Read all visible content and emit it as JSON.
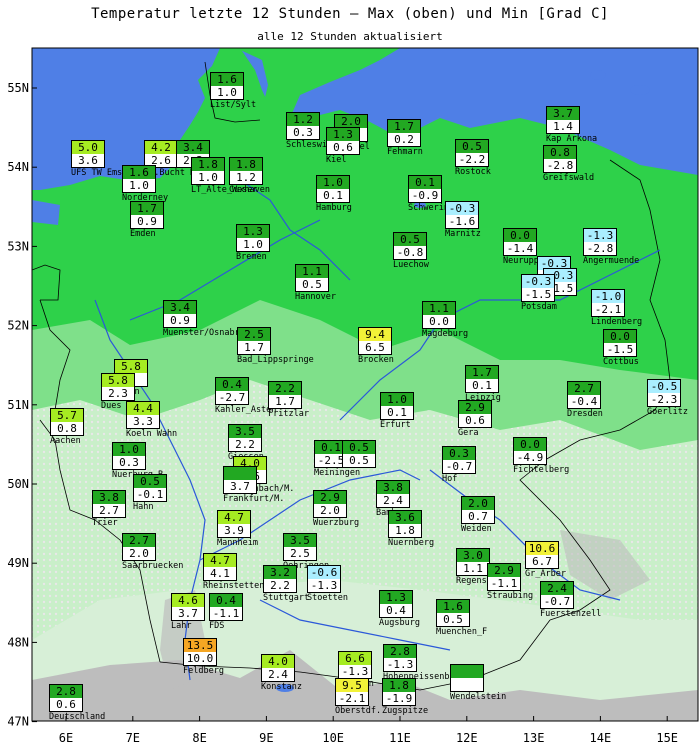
{
  "title": "Temperatur letzte 12 Stunden — Max (oben) und Min [Grad C]",
  "subtitle": "alle 12 Stunden aktualisiert",
  "axes": {
    "lon_ticks": [
      "6E",
      "7E",
      "8E",
      "9E",
      "10E",
      "11E",
      "12E",
      "13E",
      "14E",
      "15E"
    ],
    "lat_ticks": [
      "55N",
      "54N",
      "53N",
      "52N",
      "51N",
      "50N",
      "49N",
      "48N",
      "47N"
    ]
  },
  "colors": {
    "sea": "#4f7fe6",
    "lowland": "#2ed14a",
    "midland": "#7fe08a",
    "upland": "#c9efc9",
    "mountain": "#bdbdbd",
    "max_green": "#22a822",
    "max_light": "#a6ec22",
    "max_yellow": "#f2f238",
    "max_orange": "#f5a623",
    "max_cyan": "#aaeeff"
  },
  "stations": [
    {
      "name": "List/Sylt",
      "max": "1.6",
      "min": "1.0",
      "lon": 8.41,
      "lat": 55.02,
      "c": "max_green"
    },
    {
      "name": "UFS TW Ems",
      "max": "5.0",
      "min": "3.6",
      "lon": 6.33,
      "lat": 54.17,
      "c": "max_light"
    },
    {
      "name": "Dt.Bucht H.",
      "max": "4.2",
      "min": "2.6",
      "lon": 7.42,
      "lat": 54.17,
      "c": "max_light"
    },
    {
      "name": "",
      "max": "3.4",
      "min": "2.3",
      "lon": 7.9,
      "lat": 54.17,
      "c": "max_green"
    },
    {
      "name": "Schleswig",
      "max": "1.2",
      "min": "0.3",
      "lon": 9.55,
      "lat": 54.52,
      "c": "max_green"
    },
    {
      "name": "LT_Kiel",
      "max": "2.0",
      "min": "",
      "lon": 10.27,
      "lat": 54.5,
      "c": "max_green"
    },
    {
      "name": "Kiel",
      "max": "1.3",
      "min": "0.6",
      "lon": 10.15,
      "lat": 54.33,
      "c": "max_green"
    },
    {
      "name": "Fehmarn",
      "max": "1.7",
      "min": "0.2",
      "lon": 11.06,
      "lat": 54.43,
      "c": "max_green"
    },
    {
      "name": "Kap Arkona",
      "max": "3.7",
      "min": "1.4",
      "lon": 13.44,
      "lat": 54.6,
      "c": "max_green"
    },
    {
      "name": "Rostock",
      "max": "0.5",
      "min": "-2.2",
      "lon": 12.08,
      "lat": 54.18,
      "c": "max_green"
    },
    {
      "name": "Greifswald",
      "max": "0.8",
      "min": "-2.8",
      "lon": 13.4,
      "lat": 54.1,
      "c": "max_green"
    },
    {
      "name": "Cuxhaven",
      "max": "1.8",
      "min": "1.2",
      "lon": 8.7,
      "lat": 53.95,
      "c": "max_green"
    },
    {
      "name": "Norderney",
      "max": "1.6",
      "min": "1.0",
      "lon": 7.1,
      "lat": 53.85,
      "c": "max_green"
    },
    {
      "name": "LT_Alte_Weser",
      "max": "1.8",
      "min": "1.0",
      "lon": 8.13,
      "lat": 53.95,
      "c": "max_green"
    },
    {
      "name": "Hamburg",
      "max": "1.0",
      "min": "0.1",
      "lon": 9.99,
      "lat": 53.73,
      "c": "max_green"
    },
    {
      "name": "Schwerin",
      "max": "0.1",
      "min": "-0.9",
      "lon": 11.38,
      "lat": 53.73,
      "c": "max_green"
    },
    {
      "name": "Marnitz",
      "max": "-0.3",
      "min": "-1.6",
      "lon": 11.93,
      "lat": 53.4,
      "c": "max_cyan"
    },
    {
      "name": "Emden",
      "max": "1.7",
      "min": "0.9",
      "lon": 7.21,
      "lat": 53.4,
      "c": "max_green"
    },
    {
      "name": "Neuruppin",
      "max": "0.0",
      "min": "-1.4",
      "lon": 12.8,
      "lat": 53.05,
      "c": "max_green"
    },
    {
      "name": "Angermuende",
      "max": "-1.3",
      "min": "-2.8",
      "lon": 13.99,
      "lat": 53.05,
      "c": "max_cyan"
    },
    {
      "name": "Bremen",
      "max": "1.3",
      "min": "1.0",
      "lon": 8.8,
      "lat": 53.1,
      "c": "max_green"
    },
    {
      "name": "Luechow",
      "max": "0.5",
      "min": "-0.8",
      "lon": 11.15,
      "lat": 53.0,
      "c": "max_green"
    },
    {
      "name": "Tegel",
      "max": "-0.3",
      "min": "",
      "lon": 13.3,
      "lat": 52.7,
      "c": "max_cyan"
    },
    {
      "name": "",
      "max": "-0.3",
      "min": "-1.5",
      "lon": 13.4,
      "lat": 52.55,
      "c": "max_cyan"
    },
    {
      "name": "Potsdam",
      "max": "-0.3",
      "min": "-1.5",
      "lon": 13.06,
      "lat": 52.47,
      "c": "max_cyan"
    },
    {
      "name": "Hannover",
      "max": "1.1",
      "min": "0.5",
      "lon": 9.68,
      "lat": 52.6,
      "c": "max_green"
    },
    {
      "name": "Lindenberg",
      "max": "-1.0",
      "min": "-2.1",
      "lon": 14.12,
      "lat": 52.28,
      "c": "max_cyan"
    },
    {
      "name": "Muenster/Osnabr.",
      "max": "3.4",
      "min": "0.9",
      "lon": 7.7,
      "lat": 52.15,
      "c": "max_green"
    },
    {
      "name": "Magdeburg",
      "max": "1.1",
      "min": "0.0",
      "lon": 11.58,
      "lat": 52.13,
      "c": "max_green"
    },
    {
      "name": "Bad_Lippspringe",
      "max": "2.5",
      "min": "1.7",
      "lon": 8.82,
      "lat": 51.8,
      "c": "max_green"
    },
    {
      "name": "Brocken",
      "max": "9.4",
      "min": "6.5",
      "lon": 10.62,
      "lat": 51.8,
      "c": "max_yellow"
    },
    {
      "name": "Cottbus",
      "max": "0.0",
      "min": "-1.5",
      "lon": 14.3,
      "lat": 51.78,
      "c": "max_green"
    },
    {
      "name": "Essen",
      "max": "5.8",
      "min": "5",
      "lon": 6.98,
      "lat": 51.4,
      "c": "max_light"
    },
    {
      "name": "Dues",
      "max": "5.8",
      "min": "2.3",
      "lon": 6.78,
      "lat": 51.22,
      "c": "max_light"
    },
    {
      "name": "Leipzig",
      "max": "1.7",
      "min": "0.1",
      "lon": 12.23,
      "lat": 51.33,
      "c": "max_green"
    },
    {
      "name": "Kahler_Asten",
      "max": "0.4",
      "min": "-2.7",
      "lon": 8.48,
      "lat": 51.18,
      "c": "max_green"
    },
    {
      "name": "Fritzlar",
      "max": "2.2",
      "min": "1.7",
      "lon": 9.28,
      "lat": 51.13,
      "c": "max_green"
    },
    {
      "name": "Erfurt",
      "max": "1.0",
      "min": "0.1",
      "lon": 10.96,
      "lat": 50.98,
      "c": "max_green"
    },
    {
      "name": "Dresden",
      "max": "2.7",
      "min": "-0.4",
      "lon": 13.75,
      "lat": 51.13,
      "c": "max_green"
    },
    {
      "name": "Goerlitz",
      "max": "-0.5",
      "min": "-2.3",
      "lon": 14.95,
      "lat": 51.15,
      "c": "max_cyan"
    },
    {
      "name": "Koeln Wahn",
      "max": "4.4",
      "min": "3.3",
      "lon": 7.15,
      "lat": 50.87,
      "c": "max_light"
    },
    {
      "name": "Aachen",
      "max": "5.7",
      "min": "0.8",
      "lon": 6.02,
      "lat": 50.78,
      "c": "max_light"
    },
    {
      "name": "Gera",
      "max": "2.9",
      "min": "0.6",
      "lon": 12.13,
      "lat": 50.88,
      "c": "max_green"
    },
    {
      "name": "Giessen",
      "max": "3.5",
      "min": "2.2",
      "lon": 8.68,
      "lat": 50.58,
      "c": "max_green"
    },
    {
      "name": "Meiningen",
      "max": "0.1",
      "min": "-2.5",
      "lon": 9.96,
      "lat": 50.38,
      "c": "max_green"
    },
    {
      "name": "",
      "max": "0.5",
      "min": "0.5",
      "lon": 10.38,
      "lat": 50.38,
      "c": "max_green"
    },
    {
      "name": "Nuerburg_B.",
      "max": "1.0",
      "min": "0.3",
      "lon": 6.95,
      "lat": 50.35,
      "c": "max_green"
    },
    {
      "name": "Hof",
      "max": "0.3",
      "min": "-0.7",
      "lon": 11.88,
      "lat": 50.3,
      "c": "max_green"
    },
    {
      "name": "Fichtelberg",
      "max": "0.0",
      "min": "-4.9",
      "lon": 12.95,
      "lat": 50.42,
      "c": "max_green"
    },
    {
      "name": "Offenbach/M.",
      "max": "4.0",
      "min": "3.6",
      "lon": 8.75,
      "lat": 50.18,
      "c": "max_light"
    },
    {
      "name": "Frankfurt/M.",
      "max": "",
      "min": "3.7",
      "lon": 8.6,
      "lat": 50.05,
      "c": "max_green"
    },
    {
      "name": "Bamberg",
      "max": "3.8",
      "min": "2.4",
      "lon": 10.9,
      "lat": 49.88,
      "c": "max_green"
    },
    {
      "name": "Trier",
      "max": "3.8",
      "min": "2.7",
      "lon": 6.65,
      "lat": 49.75,
      "c": "max_green"
    },
    {
      "name": "Hahn",
      "max": "0.5",
      "min": "-0.1",
      "lon": 7.26,
      "lat": 49.95,
      "c": "max_green"
    },
    {
      "name": "Wuerzburg",
      "max": "2.9",
      "min": "2.0",
      "lon": 9.95,
      "lat": 49.75,
      "c": "max_green"
    },
    {
      "name": "Weiden",
      "max": "2.0",
      "min": "0.7",
      "lon": 12.17,
      "lat": 49.67,
      "c": "max_green"
    },
    {
      "name": "Mannheim",
      "max": "4.7",
      "min": "3.9",
      "lon": 8.52,
      "lat": 49.5,
      "c": "max_light"
    },
    {
      "name": "Nuernberg",
      "max": "3.6",
      "min": "1.8",
      "lon": 11.08,
      "lat": 49.5,
      "c": "max_green"
    },
    {
      "name": "Saarbruecken",
      "max": "2.7",
      "min": "2.0",
      "lon": 7.1,
      "lat": 49.2,
      "c": "max_green"
    },
    {
      "name": "Oehringen",
      "max": "3.5",
      "min": "2.5",
      "lon": 9.5,
      "lat": 49.2,
      "c": "max_green"
    },
    {
      "name": "Regensburg",
      "max": "3.0",
      "min": "1.1",
      "lon": 12.1,
      "lat": 49.02,
      "c": "max_green"
    },
    {
      "name": "Gr_Arber",
      "max": "10.6",
      "min": "6.7",
      "lon": 13.13,
      "lat": 49.1,
      "c": "max_yellow"
    },
    {
      "name": "Rheinstetten",
      "max": "4.7",
      "min": "4.1",
      "lon": 8.3,
      "lat": 48.95,
      "c": "max_light"
    },
    {
      "name": "Straubing",
      "max": "2.9",
      "min": "-1.1",
      "lon": 12.55,
      "lat": 48.83,
      "c": "max_green"
    },
    {
      "name": "Stuttgart",
      "max": "3.2",
      "min": "2.2",
      "lon": 9.2,
      "lat": 48.8,
      "c": "max_green"
    },
    {
      "name": "Stoetten",
      "max": "-0.6",
      "min": "-1.3",
      "lon": 9.86,
      "lat": 48.8,
      "c": "max_cyan"
    },
    {
      "name": "Fuerstenzell",
      "max": "2.4",
      "min": "-0.7",
      "lon": 13.35,
      "lat": 48.6,
      "c": "max_green"
    },
    {
      "name": "Lahr",
      "max": "4.6",
      "min": "3.7",
      "lon": 7.82,
      "lat": 48.45,
      "c": "max_light"
    },
    {
      "name": "FDS",
      "max": "0.4",
      "min": "-1.1",
      "lon": 8.4,
      "lat": 48.45,
      "c": "max_green"
    },
    {
      "name": "Augsburg",
      "max": "1.3",
      "min": "0.4",
      "lon": 10.94,
      "lat": 48.48,
      "c": "max_green"
    },
    {
      "name": "Muenchen_F",
      "max": "1.6",
      "min": "0.5",
      "lon": 11.79,
      "lat": 48.37,
      "c": "max_green"
    },
    {
      "name": "Hohenpeissenberg",
      "max": "2.8",
      "min": "-1.3",
      "lon": 11.0,
      "lat": 47.8,
      "c": "max_green"
    },
    {
      "name": "Feldberg",
      "max": "13.5",
      "min": "10.0",
      "lon": 8.0,
      "lat": 47.88,
      "c": "max_orange"
    },
    {
      "name": "Kempten",
      "max": "6.6",
      "min": "-1.3",
      "lon": 10.32,
      "lat": 47.72,
      "c": "max_light"
    },
    {
      "name": "Konstanz",
      "max": "4.0",
      "min": "2.4",
      "lon": 9.18,
      "lat": 47.68,
      "c": "max_light"
    },
    {
      "name": "Deutschland",
      "max": "2.8",
      "min": "0.6",
      "lon": 6.0,
      "lat": 47.3,
      "c": "max_green"
    },
    {
      "name": "Oberstdf.",
      "max": "9.5",
      "min": "-2.1",
      "lon": 10.28,
      "lat": 47.38,
      "c": "max_yellow"
    },
    {
      "name": "Zugspitze",
      "max": "1.8",
      "min": "-1.9",
      "lon": 10.98,
      "lat": 47.38,
      "c": "max_green"
    },
    {
      "name": "Wendelstein",
      "max": "",
      "min": "",
      "lon": 12.0,
      "lat": 47.55,
      "c": "max_green"
    }
  ]
}
